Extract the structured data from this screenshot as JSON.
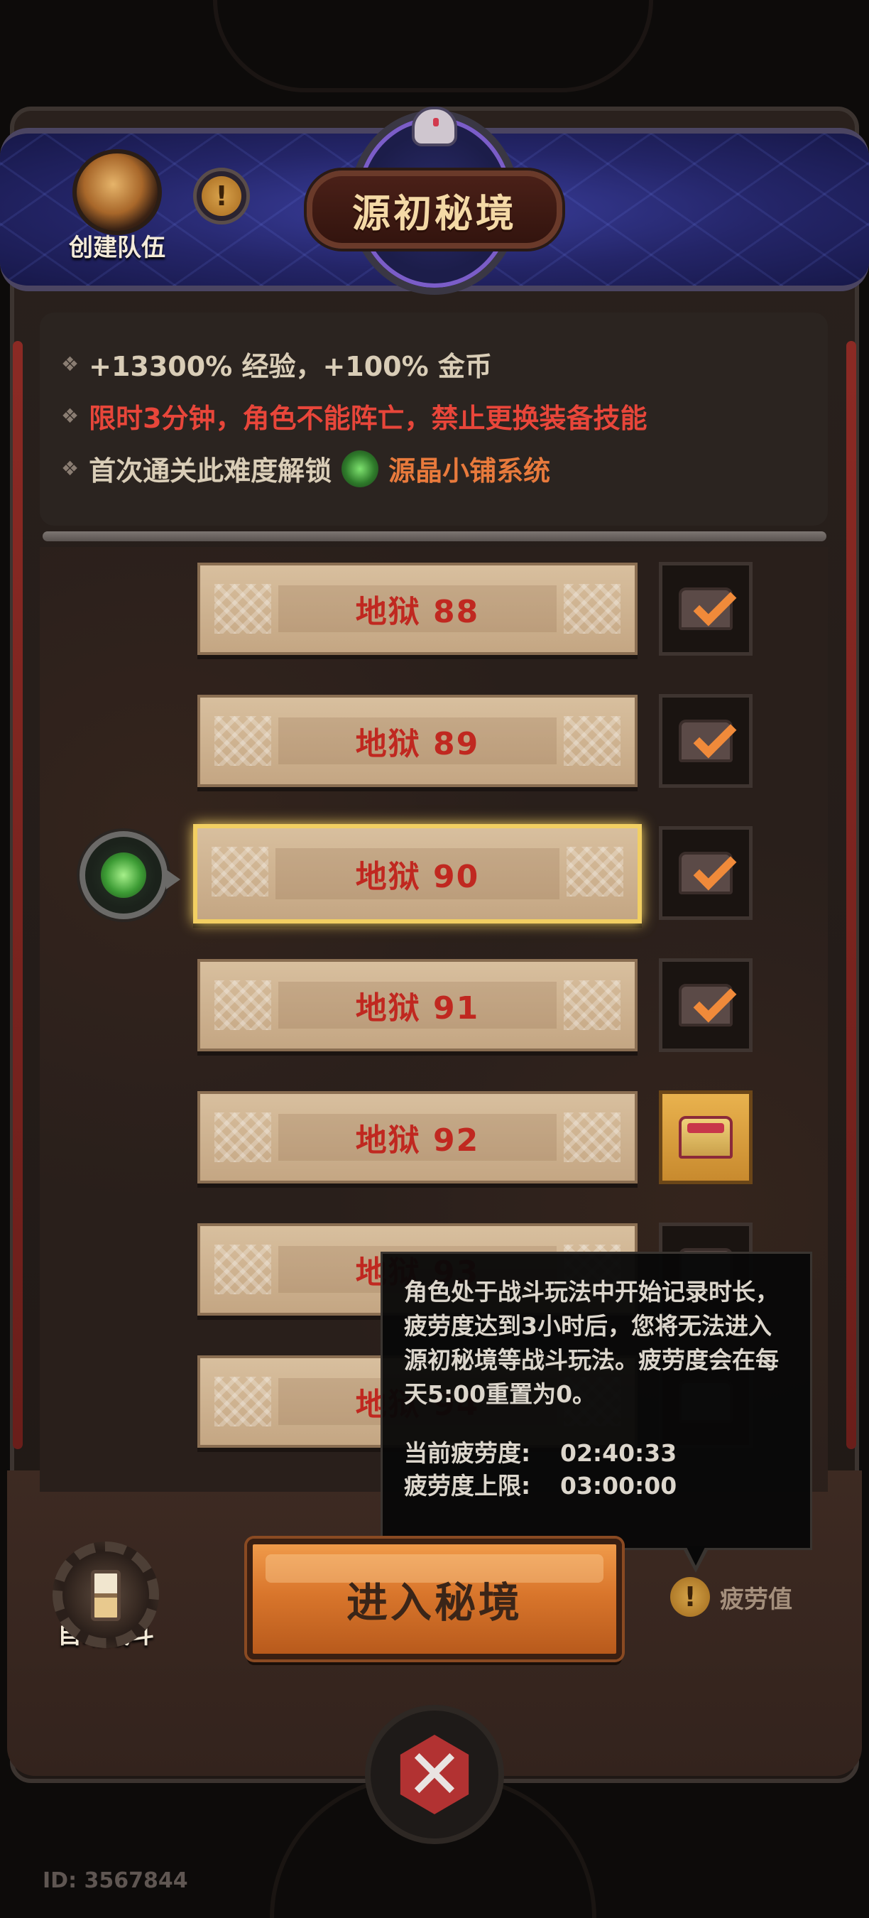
{
  "header": {
    "title": "源初秘境",
    "create_team_label": "创建队伍",
    "info_icon": "info-icon"
  },
  "bonuses": {
    "line1": "+13300% 经验，+100% 金币",
    "line2": "限时3分钟，角色不能阵亡，禁止更换装备技能",
    "line3_prefix": "首次通关此难度解锁",
    "line3_shop": "源晶小铺系统",
    "line2_color": "#e8463a",
    "shop_color": "#e87a3c"
  },
  "levels": [
    {
      "label": "地狱 88",
      "reward": "claimed"
    },
    {
      "label": "地狱 89",
      "reward": "claimed"
    },
    {
      "label": "地狱 90",
      "reward": "claimed",
      "selected": true
    },
    {
      "label": "地狱 91",
      "reward": "claimed"
    },
    {
      "label": "地狱 92",
      "reward": "available"
    },
    {
      "label": "地狱 93",
      "reward": "locked"
    },
    {
      "label": "地狱 94",
      "reward": "locked"
    }
  ],
  "tooltip": {
    "description": "角色处于战斗玩法中开始记录时长，疲劳度达到3小时后，您将无法进入源初秘境等战斗玩法。疲劳度会在每天5:00重置为0。",
    "current_label": "当前疲劳度:",
    "current_value": "02:40:33",
    "limit_label": "疲劳度上限:",
    "limit_value": "03:00:00"
  },
  "controls": {
    "auto_battle_label": "自动战斗",
    "enter_label": "进入秘境",
    "fatigue_label": "疲劳值",
    "close_symbol": "✕"
  },
  "footer": {
    "user_id": "ID: 3567844"
  },
  "colors": {
    "accent_orange": "#d9762c",
    "level_text": "#c02820",
    "selected_border": "#f2cf62"
  }
}
